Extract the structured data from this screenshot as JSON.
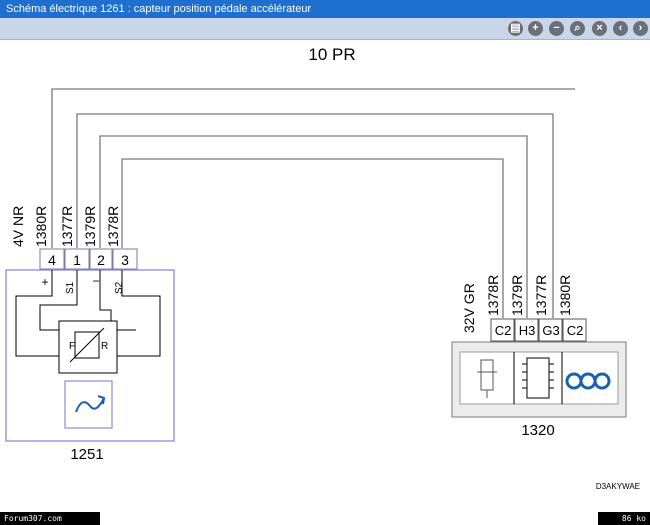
{
  "window": {
    "title": "Schéma électrique 1261 : capteur position pédale accélérateur"
  },
  "toolbar": {
    "buttons": [
      {
        "name": "print-icon",
        "glyph": "▤"
      },
      {
        "name": "zoom-in-icon",
        "glyph": "+"
      },
      {
        "name": "zoom-out-icon",
        "glyph": "−"
      },
      {
        "name": "search-icon",
        "glyph": "⌕"
      },
      {
        "name": "close-x-icon",
        "glyph": "×"
      },
      {
        "name": "back-icon",
        "glyph": "‹"
      },
      {
        "name": "forward-icon",
        "glyph": "›"
      }
    ]
  },
  "diagram": {
    "header_label": "10 PR",
    "left_wire_labels": [
      "4V NR",
      "1380R",
      "1377R",
      "1379R",
      "1378R"
    ],
    "left_pins": [
      "4",
      "1",
      "2",
      "3"
    ],
    "left_pin_signs": [
      "+",
      "S1",
      "−",
      "S2"
    ],
    "left_component_id": "1251",
    "right_wire_labels": [
      "32V GR",
      "1378R",
      "1379R",
      "1377R",
      "1380R"
    ],
    "right_pins": [
      "C2",
      "H3",
      "G3",
      "C2"
    ],
    "right_component_id": "1320",
    "resistor_letters": [
      "F",
      "R"
    ],
    "reference_code": "D3AKYWAE"
  },
  "footer": {
    "left_text": "Forum307.com",
    "right_text": "86 ko"
  },
  "colors": {
    "title_bar": "#1e6fd0",
    "toolbar": "#c9d5e8",
    "component_border": "#8a8ad8",
    "coil": "#1a5fb0"
  }
}
